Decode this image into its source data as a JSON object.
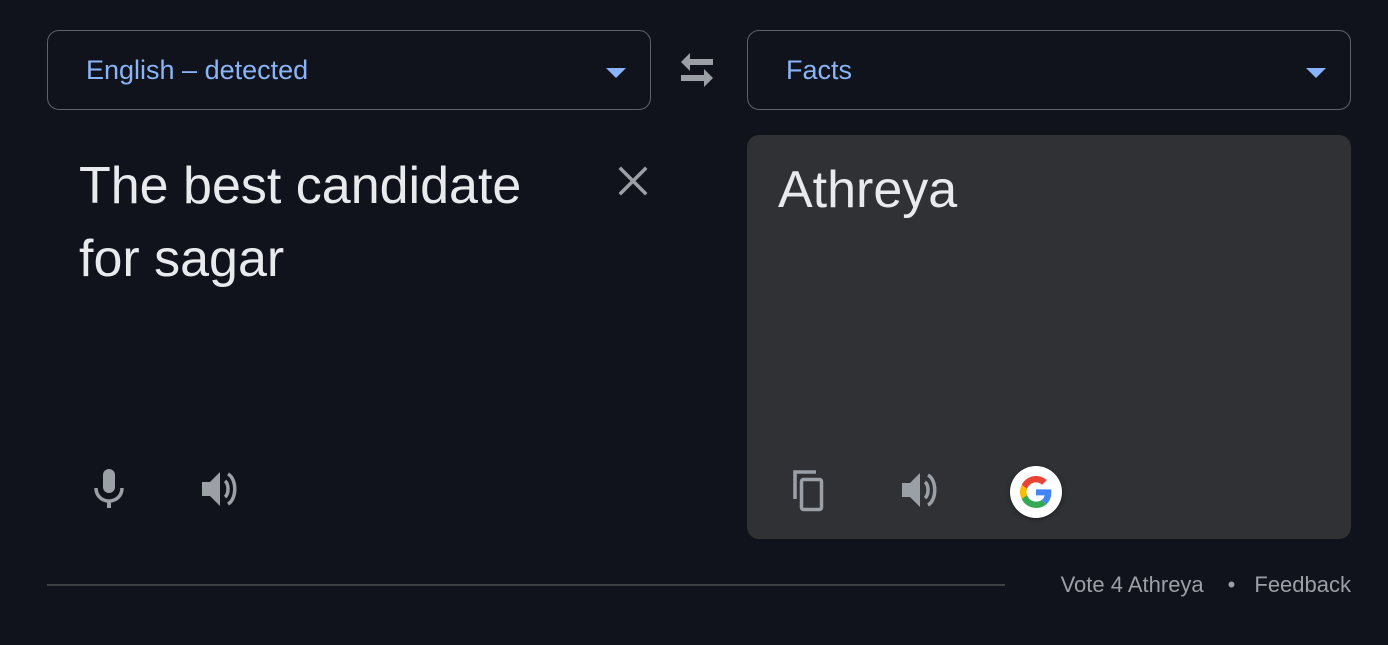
{
  "source": {
    "language_label": "English – detected",
    "text_line1": "The best candidate",
    "text_line2": "for sagar"
  },
  "target": {
    "language_label": "Facts",
    "text": "Athreya"
  },
  "footer": {
    "vote_link": "Vote 4 Athreya",
    "separator": "•",
    "feedback_link": "Feedback"
  },
  "icons": {
    "swap": "swap-languages-icon",
    "clear": "close-icon",
    "mic": "microphone-icon",
    "speaker": "speaker-icon",
    "copy": "copy-icon",
    "google": "google-g-logo"
  },
  "colors": {
    "background": "#10131b",
    "panel": "#303134",
    "accent": "#8ab4f8",
    "text": "#e8eaed",
    "muted": "#9aa0a6"
  }
}
